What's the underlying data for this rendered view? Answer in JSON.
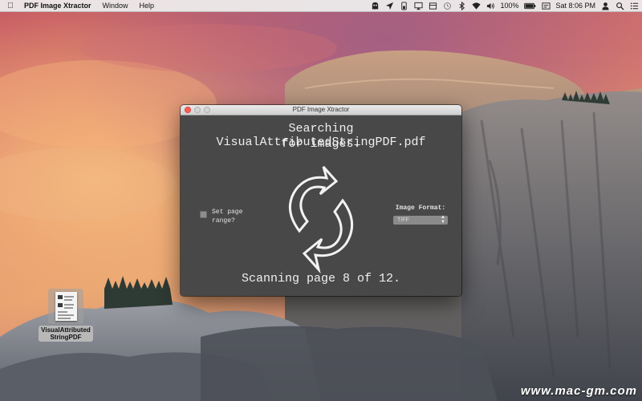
{
  "menubar": {
    "app_name": "PDF Image Xtractor",
    "menus": [
      "Window",
      "Help"
    ],
    "battery": "100%",
    "clock": "Sat 8:06 PM",
    "status_icons": [
      "ghost-icon",
      "location-icon",
      "battery-bar-icon",
      "airplay-icon",
      "box-icon",
      "time-machine-icon",
      "bluetooth-icon",
      "wifi-icon",
      "volume-icon",
      "battery-icon",
      "input-menu-icon",
      "user-icon",
      "spotlight-icon",
      "notification-center-icon"
    ]
  },
  "window": {
    "title": "PDF Image Xtractor",
    "search_line1": "Searching VisualAttributedStringPDF.pdf",
    "search_line2": "for images.",
    "page_range_label": "Set page range?",
    "image_format_label": "Image Format:",
    "image_format_value": "TIFF",
    "status": "Scanning page 8 of 12."
  },
  "desktop": {
    "file_name_line1": "VisualAttributed",
    "file_name_line2": "StringPDF"
  },
  "watermark": "www.mac-gm.com",
  "colors": {
    "window_bg": "#474747",
    "close_button": "#fc5f57",
    "text": "#efefef"
  }
}
